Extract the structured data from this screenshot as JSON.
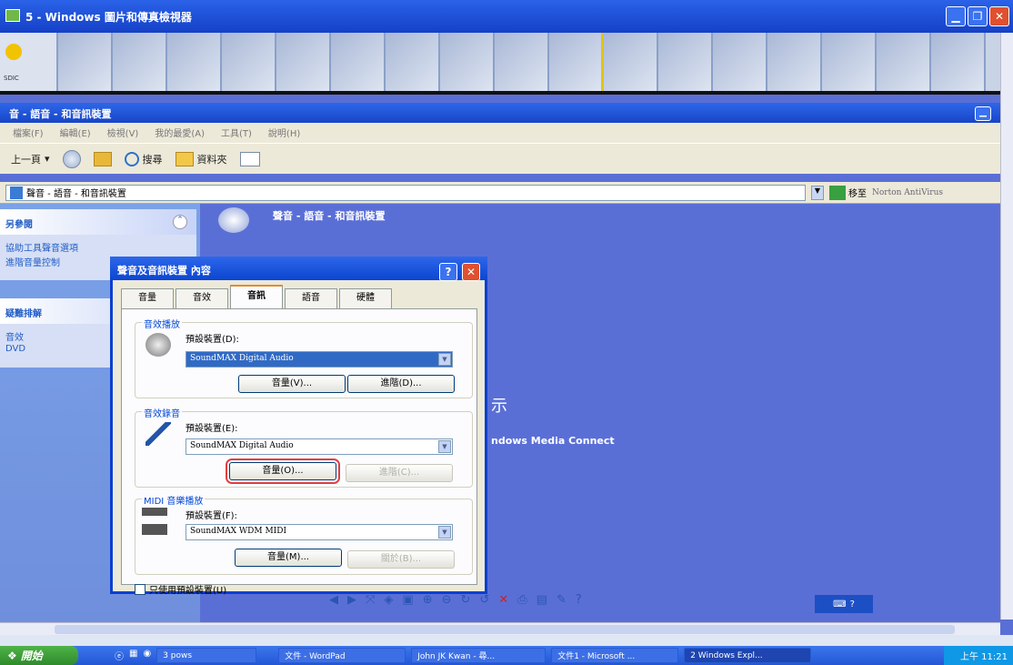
{
  "photo_viewer": {
    "title": "5 - Windows 圖片和傳真檢視器"
  },
  "thumb_text": "SDIC",
  "sound_window": {
    "title": "音 - 語音 - 和音訊裝置",
    "menu": [
      "檔案(F)",
      "編輯(E)",
      "檢視(V)",
      "我的最愛(A)",
      "工具(T)",
      "說明(H)"
    ],
    "toolbar": {
      "back": "上一頁",
      "search": "搜尋",
      "folders": "資料夾"
    },
    "address": "聲音 - 語音 - 和音訊裝置",
    "goto": "移至",
    "norton": "Norton AntiVirus"
  },
  "left_pane": {
    "see_also": "另參閱",
    "see_also_links": [
      "協助工具聲音選項",
      "進階音量控制"
    ],
    "troubleshoot": "疑難排解",
    "troubleshoot_links": [
      "音效",
      "DVD"
    ]
  },
  "right_pane": {
    "category": "聲音 - 語音 - 和音訊裝置",
    "bg_text_1": "示",
    "bg_text_2": "ndows Media Connect"
  },
  "dialog": {
    "title": "聲音及音訊裝置 內容",
    "tabs": [
      "音量",
      "音效",
      "音訊",
      "語音",
      "硬體"
    ],
    "active_tab": "音訊",
    "playback": {
      "label": "音效播放",
      "device_label": "預設裝置(D):",
      "device": "SoundMAX Digital Audio",
      "volume_btn": "音量(V)...",
      "advanced_btn": "進階(D)..."
    },
    "recording": {
      "label": "音效錄音",
      "device_label": "預設裝置(E):",
      "device": "SoundMAX Digital Audio",
      "volume_btn": "音量(O)...",
      "advanced_btn": "進階(C)..."
    },
    "midi": {
      "label": "MIDI 音樂播放",
      "device_label": "預設裝置(F):",
      "device": "SoundMAX WDM MIDI",
      "volume_btn": "音量(M)...",
      "about_btn": "關於(B)..."
    },
    "default_only": "只使用預設裝置(U)"
  },
  "taskbar": {
    "start": "開始",
    "tasks": [
      "3 pows",
      "文件 - WordPad",
      "John JK Kwan - 尋...",
      "文件1 - Microsoft ...",
      "2 Windows Expl..."
    ],
    "clock": "上午 11:21"
  }
}
